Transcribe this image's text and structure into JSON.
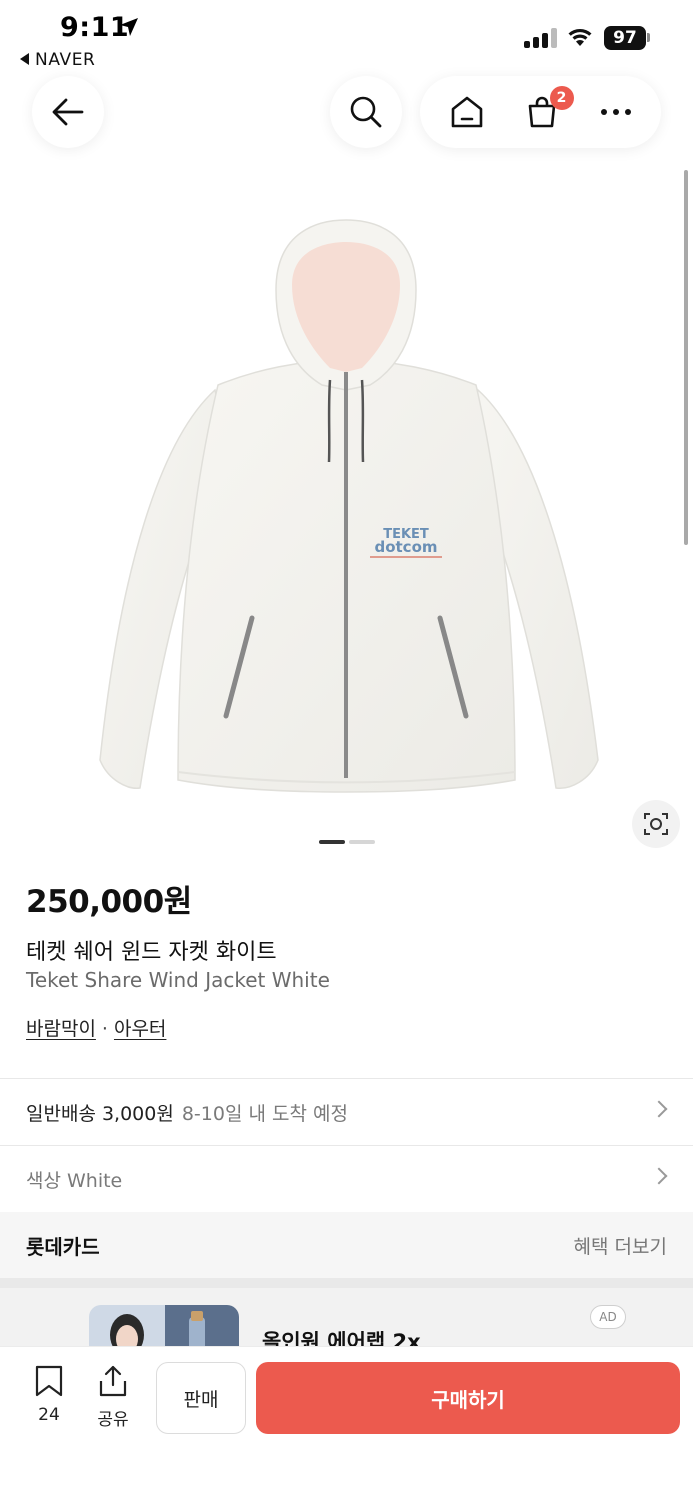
{
  "status_bar": {
    "time": "9:11",
    "back_app": "NAVER",
    "battery": "97"
  },
  "nav": {
    "back_icon": "arrow-left-icon",
    "search_icon": "search-icon",
    "home_icon": "home-icon",
    "cart_icon": "shopping-bag-icon",
    "cart_count": "2",
    "more_icon": "more-horizontal-icon"
  },
  "product": {
    "image_alt": "white hooded wind jacket",
    "logo_line1": "TEKET",
    "logo_line2": "dotcom",
    "price": "250,000원",
    "name_ko": "테켓 쉐어 윈드 자켓 화이트",
    "name_en": "Teket Share Wind Jacket White",
    "category": [
      "바람막이",
      "아우터"
    ],
    "category_sep": "·",
    "carousel_pages": 2,
    "carousel_current": 1
  },
  "shipping": {
    "label": "일반배송 3,000원",
    "eta": "8-10일 내 도착 예정"
  },
  "option": {
    "label": "색상 White"
  },
  "card_benefit": {
    "card_name": "롯데카드",
    "more": "혜택 더보기"
  },
  "ad": {
    "title": "올인원 에어랩 2x",
    "badge": "AD"
  },
  "bottom_bar": {
    "bookmark_count": "24",
    "share_label": "공유",
    "sell_label": "판매",
    "buy_label": "구매하기"
  },
  "colors": {
    "accent": "#ec5a4e",
    "text": "#111111",
    "muted": "#777777"
  }
}
